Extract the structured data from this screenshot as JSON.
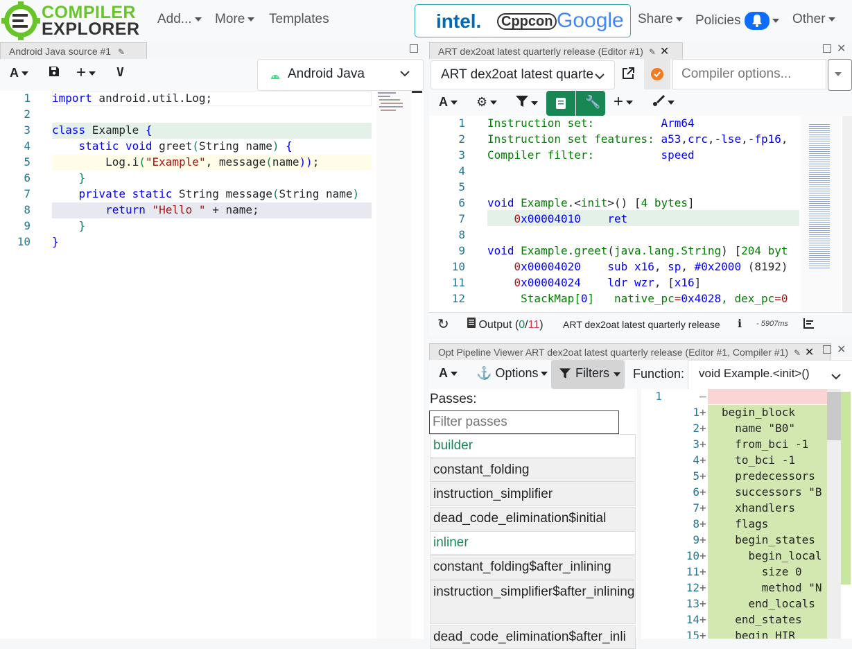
{
  "nav": {
    "logo_line1": "COMPILER",
    "logo_line2": "EXPLORER",
    "add": "Add...",
    "more": "More",
    "templates": "Templates",
    "share": "Share",
    "policies": "Policies",
    "other": "Other",
    "sponsors": [
      "intel.",
      "Cppcon",
      "Google"
    ]
  },
  "source_pane": {
    "tab_title": "Android Java source #1",
    "language": "Android Java",
    "vim_label": "V",
    "lines": [
      {
        "n": "1",
        "tokens": [
          {
            "t": "import",
            "c": "kw"
          },
          {
            "t": " android.util.Log;",
            "c": ""
          }
        ]
      },
      {
        "n": "2",
        "tokens": []
      },
      {
        "n": "3",
        "tokens": [
          {
            "t": "class",
            "c": "kw"
          },
          {
            "t": " Example ",
            "c": ""
          },
          {
            "t": "{",
            "c": "kw"
          }
        ]
      },
      {
        "n": "4",
        "tokens": [
          {
            "t": "    static void",
            "c": "kw"
          },
          {
            "t": " greet",
            "c": ""
          },
          {
            "t": "(",
            "c": "gr"
          },
          {
            "t": "String name",
            "c": ""
          },
          {
            "t": ")",
            "c": "gr"
          },
          {
            "t": " {",
            "c": "kw"
          }
        ]
      },
      {
        "n": "5",
        "tokens": [
          {
            "t": "        Log.i",
            "c": ""
          },
          {
            "t": "(",
            "c": "gr"
          },
          {
            "t": "\"Example\"",
            "c": "str"
          },
          {
            "t": ", message",
            "c": ""
          },
          {
            "t": "(",
            "c": "gr"
          },
          {
            "t": "name",
            "c": ""
          },
          {
            "t": "))",
            "c": "kw"
          },
          {
            "t": ";",
            "c": ""
          }
        ]
      },
      {
        "n": "6",
        "tokens": [
          {
            "t": "    }",
            "c": "gr"
          }
        ]
      },
      {
        "n": "7",
        "tokens": [
          {
            "t": "    private static",
            "c": "kw"
          },
          {
            "t": " String message",
            "c": ""
          },
          {
            "t": "(",
            "c": "gr"
          },
          {
            "t": "String name",
            "c": ""
          },
          {
            "t": ")",
            "c": "gr"
          }
        ]
      },
      {
        "n": "8",
        "tokens": [
          {
            "t": "        return",
            "c": "kw"
          },
          {
            "t": " ",
            "c": ""
          },
          {
            "t": "\"Hello \"",
            "c": "str"
          },
          {
            "t": " + name;",
            "c": ""
          }
        ]
      },
      {
        "n": "9",
        "tokens": [
          {
            "t": "    }",
            "c": "gr"
          }
        ]
      },
      {
        "n": "10",
        "tokens": [
          {
            "t": "}",
            "c": "kw"
          }
        ]
      }
    ]
  },
  "compiler_pane": {
    "tab_title": "ART dex2oat latest quarterly release (Editor #1)",
    "compiler_name": "ART dex2oat latest quarte",
    "options_placeholder": "Compiler options...",
    "lines": [
      {
        "n": "1",
        "tokens": [
          {
            "t": "Instruction set:          ",
            "c": "cm"
          },
          {
            "t": "Arm64",
            "c": "kw"
          }
        ]
      },
      {
        "n": "2",
        "tokens": [
          {
            "t": "Instruction set features: ",
            "c": "cm"
          },
          {
            "t": "a53",
            "c": "kw"
          },
          {
            "t": ",",
            "c": ""
          },
          {
            "t": "crc",
            "c": "kw"
          },
          {
            "t": ",-",
            "c": ""
          },
          {
            "t": "lse",
            "c": "kw"
          },
          {
            "t": ",-",
            "c": ""
          },
          {
            "t": "fp16",
            "c": "kw"
          },
          {
            "t": ",",
            "c": ""
          }
        ]
      },
      {
        "n": "3",
        "tokens": [
          {
            "t": "Compiler filter:          ",
            "c": "cm"
          },
          {
            "t": "speed",
            "c": "kw"
          }
        ]
      },
      {
        "n": "4",
        "tokens": []
      },
      {
        "n": "5",
        "tokens": []
      },
      {
        "n": "6",
        "tokens": [
          {
            "t": "void",
            "c": "kw"
          },
          {
            "t": " Example",
            "c": "cm"
          },
          {
            "t": ".<",
            "c": ""
          },
          {
            "t": "init",
            "c": "cm"
          },
          {
            "t": ">() [",
            "c": ""
          },
          {
            "t": "4 bytes",
            "c": "cm"
          },
          {
            "t": "]",
            "c": ""
          }
        ]
      },
      {
        "n": "7",
        "tokens": [
          {
            "t": "    0",
            "c": "str"
          },
          {
            "t": "x00004010",
            "c": "kw"
          },
          {
            "t": "    ret",
            "c": "kw"
          }
        ]
      },
      {
        "n": "8",
        "tokens": []
      },
      {
        "n": "9",
        "tokens": [
          {
            "t": "void",
            "c": "kw"
          },
          {
            "t": " Example",
            "c": "cm"
          },
          {
            "t": ".",
            "c": ""
          },
          {
            "t": "greet",
            "c": "cm"
          },
          {
            "t": "(",
            "c": ""
          },
          {
            "t": "java.lang.String",
            "c": "cm"
          },
          {
            "t": ") [",
            "c": ""
          },
          {
            "t": "204 byt",
            "c": "cm"
          }
        ]
      },
      {
        "n": "10",
        "tokens": [
          {
            "t": "    0",
            "c": "str"
          },
          {
            "t": "x00004020",
            "c": "kw"
          },
          {
            "t": "    sub x16",
            "c": "kw"
          },
          {
            "t": ", ",
            "c": ""
          },
          {
            "t": "sp",
            "c": "kw"
          },
          {
            "t": ", ",
            "c": ""
          },
          {
            "t": "#0x2000",
            "c": "kw"
          },
          {
            "t": " (8192)",
            "c": ""
          }
        ]
      },
      {
        "n": "11",
        "tokens": [
          {
            "t": "    0",
            "c": "str"
          },
          {
            "t": "x00004024",
            "c": "kw"
          },
          {
            "t": "    ldr wzr",
            "c": "kw"
          },
          {
            "t": ", [",
            "c": ""
          },
          {
            "t": "x16",
            "c": "kw"
          },
          {
            "t": "]",
            "c": ""
          }
        ]
      },
      {
        "n": "12",
        "tokens": [
          {
            "t": "     StackMap[",
            "c": "cm"
          },
          {
            "t": "0",
            "c": "kw"
          },
          {
            "t": "]   native_pc",
            "c": "cm"
          },
          {
            "t": "=",
            "c": "str"
          },
          {
            "t": "0x4028",
            "c": "kw"
          },
          {
            "t": ", dex_pc",
            "c": "cm"
          },
          {
            "t": "=0",
            "c": "str"
          }
        ]
      }
    ],
    "output_label": "Output (",
    "output_ok": "0",
    "output_sep": "/",
    "output_err": "11",
    "output_close": ")",
    "status_compiler": "ART dex2oat latest quarterly release",
    "timing": "- 5907ms"
  },
  "opt_pane": {
    "tab_title": "Opt Pipeline Viewer ART dex2oat latest quarterly release (Editor #1, Compiler #1)",
    "options_label": "Options",
    "filters_label": "Filters",
    "function_label": "Function:",
    "function_value": "void Example.<init>()",
    "passes_label": "Passes:",
    "filter_placeholder": "Filter passes",
    "passes": [
      {
        "name": "builder",
        "changed": true
      },
      {
        "name": "constant_folding",
        "changed": false
      },
      {
        "name": "instruction_simplifier",
        "changed": false
      },
      {
        "name": "dead_code_elimination$initial",
        "changed": false
      },
      {
        "name": "inliner",
        "changed": true
      },
      {
        "name": "constant_folding$after_inlining",
        "changed": false
      },
      {
        "name": "instruction_simplifier$after_inlining",
        "changed": false
      },
      {
        "name": "dead_code_elimination$after_inli",
        "changed": false
      }
    ],
    "diff_lines": [
      {
        "left": "1",
        "right": "",
        "mark": "–",
        "text": ""
      },
      {
        "left": "",
        "right": "1",
        "mark": "+",
        "text": "begin_block"
      },
      {
        "left": "",
        "right": "2",
        "mark": "+",
        "text": "  name \"B0\""
      },
      {
        "left": "",
        "right": "3",
        "mark": "+",
        "text": "  from_bci -1"
      },
      {
        "left": "",
        "right": "4",
        "mark": "+",
        "text": "  to_bci -1"
      },
      {
        "left": "",
        "right": "5",
        "mark": "+",
        "text": "  predecessors"
      },
      {
        "left": "",
        "right": "6",
        "mark": "+",
        "text": "  successors \"B"
      },
      {
        "left": "",
        "right": "7",
        "mark": "+",
        "text": "  xhandlers"
      },
      {
        "left": "",
        "right": "8",
        "mark": "+",
        "text": "  flags"
      },
      {
        "left": "",
        "right": "9",
        "mark": "+",
        "text": "  begin_states"
      },
      {
        "left": "",
        "right": "10",
        "mark": "+",
        "text": "    begin_local"
      },
      {
        "left": "",
        "right": "11",
        "mark": "+",
        "text": "      size 0"
      },
      {
        "left": "",
        "right": "12",
        "mark": "+",
        "text": "      method \"N"
      },
      {
        "left": "",
        "right": "13",
        "mark": "+",
        "text": "    end_locals"
      },
      {
        "left": "",
        "right": "14",
        "mark": "+",
        "text": "  end_states"
      },
      {
        "left": "",
        "right": "15",
        "mark": "+",
        "text": "  begin_HIR"
      }
    ]
  },
  "colors": {
    "brand_green": "#67c52a",
    "accent_blue": "#0d6efd",
    "added_line": "#d3e8b0",
    "diff_hl": "#e4f1e8"
  }
}
